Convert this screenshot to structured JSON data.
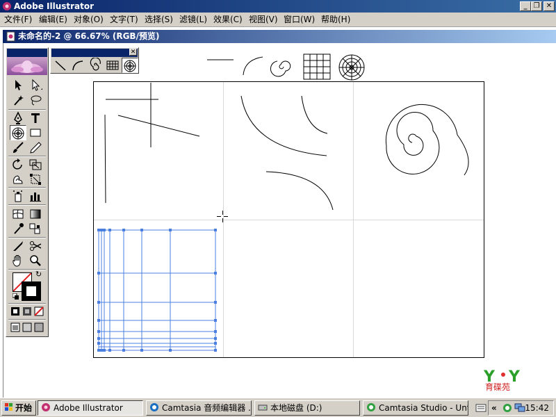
{
  "app": {
    "title": "Adobe Illustrator",
    "window_buttons": [
      "_",
      "❐",
      "✕"
    ]
  },
  "menu": [
    {
      "label": "文件(F)"
    },
    {
      "label": "编辑(E)"
    },
    {
      "label": "对象(O)"
    },
    {
      "label": "文字(T)"
    },
    {
      "label": "选择(S)"
    },
    {
      "label": "滤镜(L)"
    },
    {
      "label": "效果(C)"
    },
    {
      "label": "视图(V)"
    },
    {
      "label": "窗口(W)"
    },
    {
      "label": "帮助(H)"
    }
  ],
  "document": {
    "title": "未命名的-2 @ 66.67% (RGB/预览)"
  },
  "toolbox": {
    "tools": [
      "selection-tool",
      "direct-selection-tool",
      "magic-wand-tool",
      "lasso-tool",
      "pen-tool",
      "type-tool",
      "polar-grid-tool",
      "rectangle-tool",
      "paintbrush-tool",
      "pencil-tool",
      "rotate-tool",
      "scale-tool",
      "warp-tool",
      "free-transform-tool",
      "symbol-sprayer-tool",
      "column-graph-tool",
      "mesh-tool",
      "gradient-tool",
      "eyedropper-tool",
      "blend-tool",
      "slice-tool",
      "scissors-tool",
      "hand-tool",
      "zoom-tool"
    ],
    "active_tool": "polar-grid-tool"
  },
  "palette": {
    "close_label": "✕",
    "tools": [
      "line-segment-tool",
      "arc-tool",
      "spiral-tool",
      "rectangular-grid-tool",
      "polar-grid-tool"
    ],
    "active_tool": "polar-grid-tool"
  },
  "canvas": {
    "selection_color": "#4a7fe0"
  },
  "watermark": {
    "text": "育碟苑"
  },
  "taskbar": {
    "start_label": "开始",
    "tasks": [
      {
        "label": "Adobe Illustrator",
        "pressed": true
      },
      {
        "label": "Camtasia 音频编辑器 ...",
        "pressed": false
      },
      {
        "label": "本地磁盘 (D:)",
        "pressed": false
      },
      {
        "label": "Camtasia Studio - Untitl...",
        "pressed": false
      }
    ],
    "tray_chevron": "«",
    "clock": "15:42"
  }
}
